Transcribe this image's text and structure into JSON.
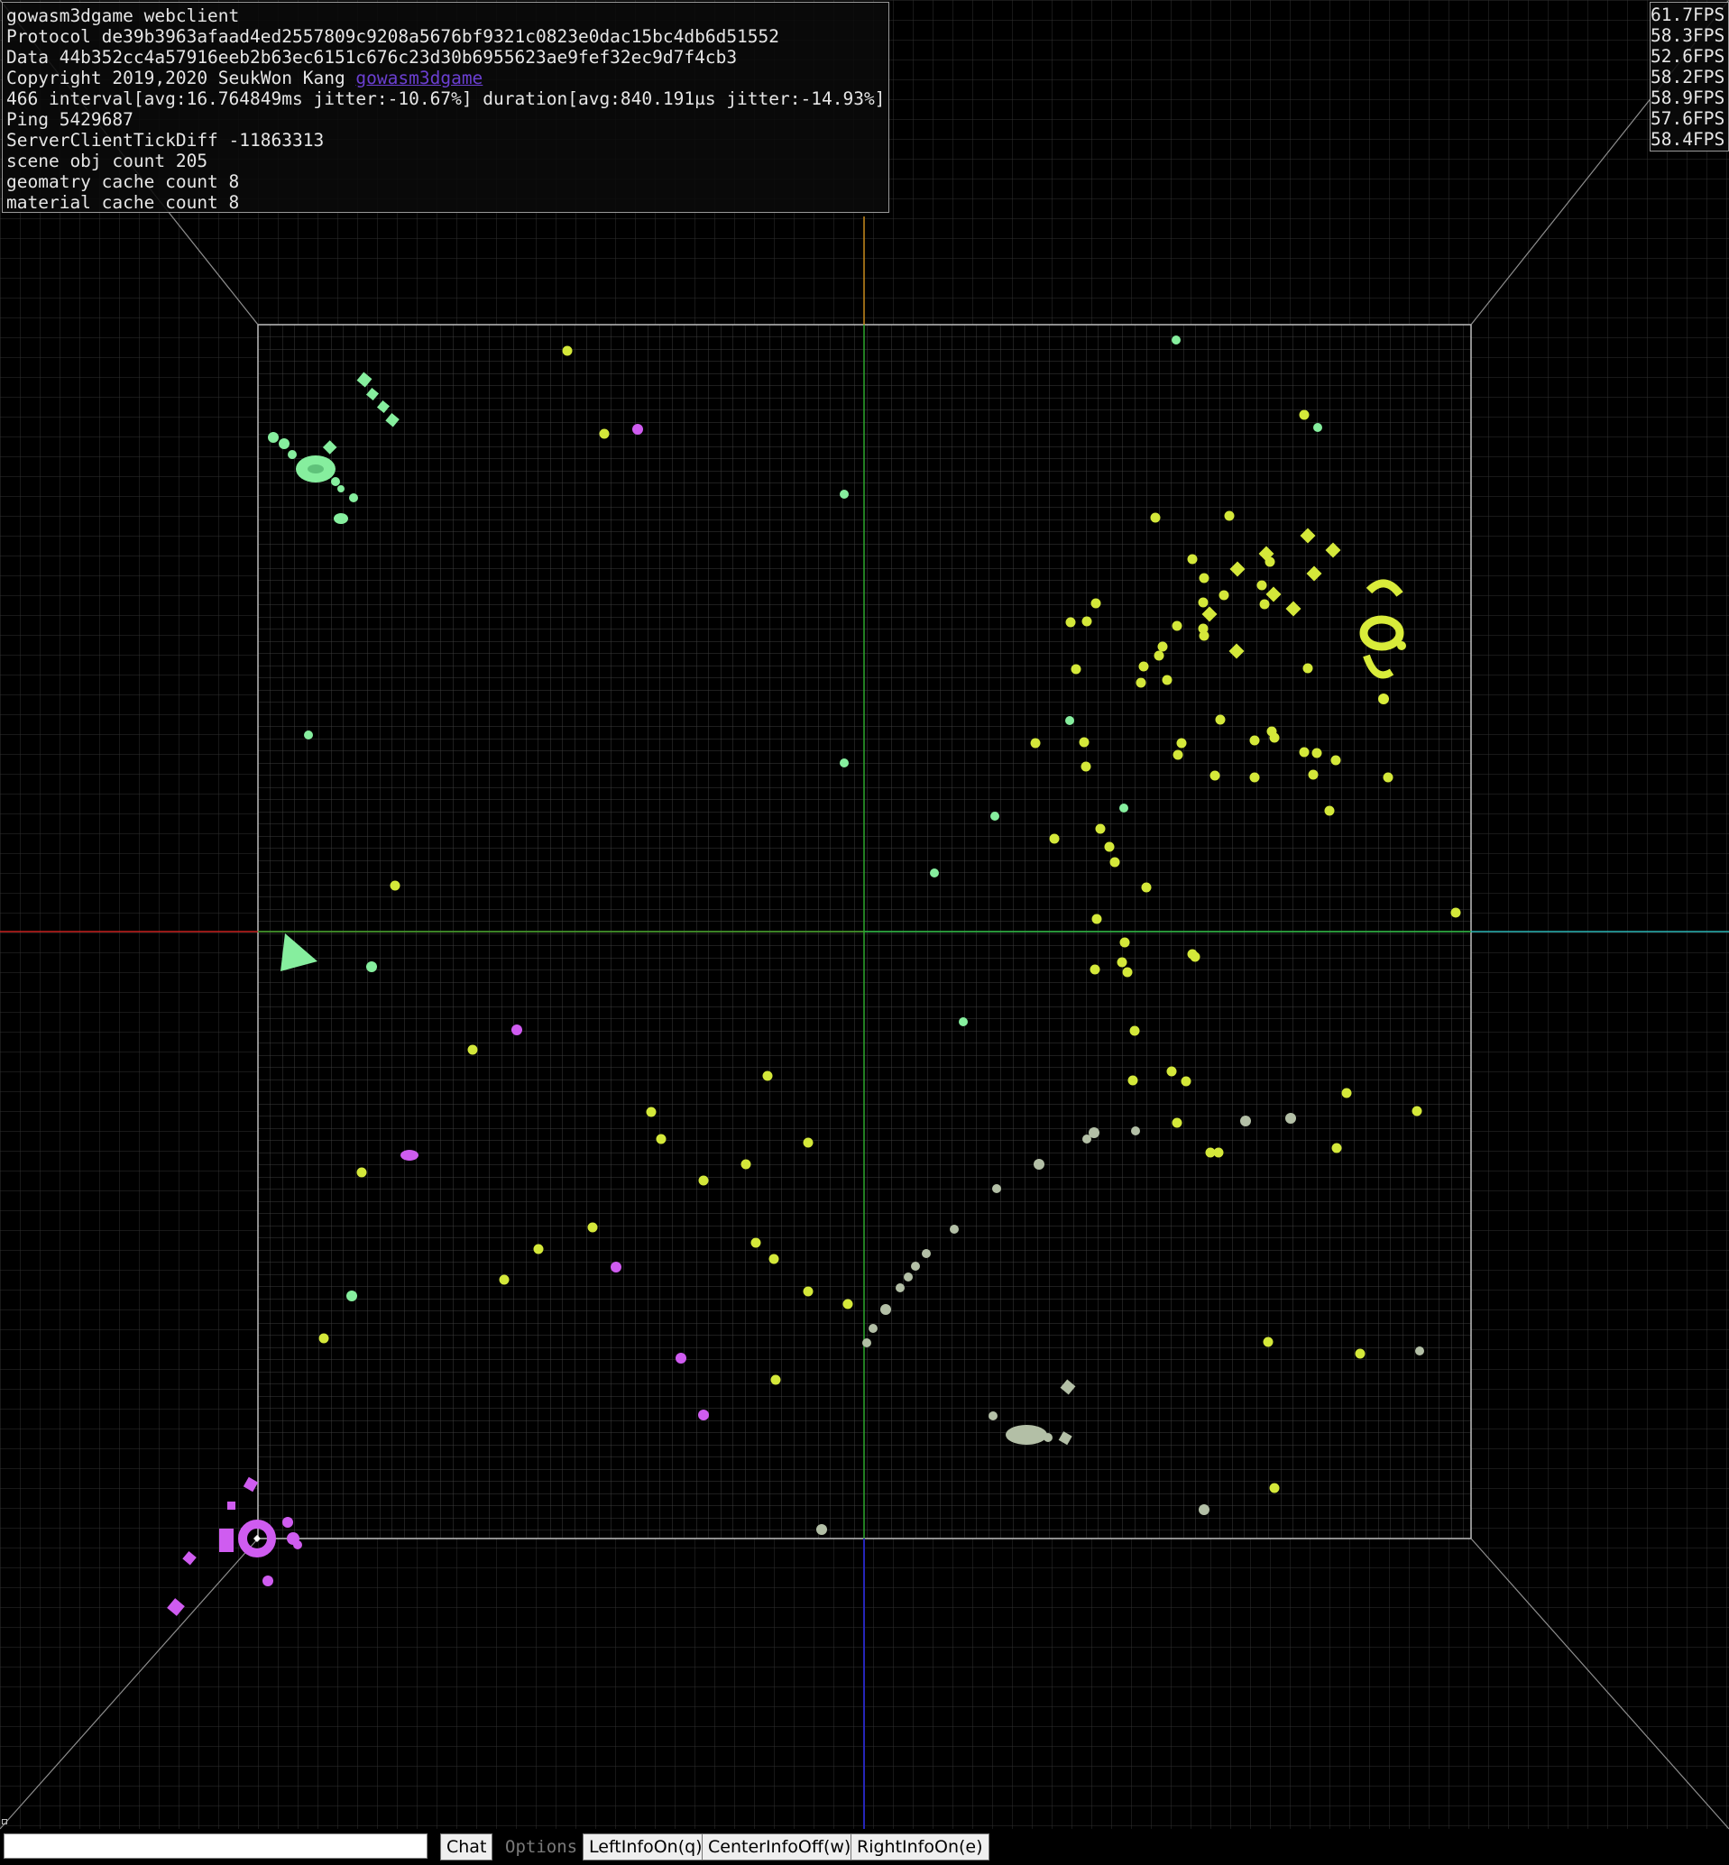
{
  "info_left": {
    "lines": [
      "gowasm3dgame webclient",
      "Protocol de39b3963afaad4ed2557809c9208a5676bf9321c0823e0dac15bc4db6d51552",
      "Data 44b352cc4a57916eeb2b63ec6151c676c23d30b6955623ae9fef32ec9d7f4cb3",
      "466 interval[avg:16.764849ms jitter:-10.67%] duration[avg:840.191µs jitter:-14.93%]",
      "Ping 5429687",
      "ServerClientTickDiff -11863313",
      "scene obj count 205",
      "geomatry cache count 8",
      "material cache count 8"
    ],
    "copyright_text": "Copyright 2019,2020 SeukWon Kang ",
    "copyright_link": "gowasm3dgame"
  },
  "fps": [
    "61.7FPS",
    "58.3FPS",
    "52.6FPS",
    "58.2FPS",
    "58.9FPS",
    "57.6FPS",
    "58.4FPS"
  ],
  "bottom_bar": {
    "chat_label": "Chat",
    "options_label": "Options",
    "left_info_label": "LeftInfoOn(q)",
    "center_info_label": "CenterInfoOff(w)",
    "right_info_label": "RightInfoOn(e)"
  },
  "colors": {
    "team_green": "#86ee9e",
    "team_yellow": "#d9ec3a",
    "team_magenta": "#cf5cf0",
    "team_gray": "#b3bfa6",
    "grid": "#3a3a3a",
    "axis_x": "#c8211f",
    "axis_y": "#2ea72e",
    "axis_z": "#2525b8"
  }
}
